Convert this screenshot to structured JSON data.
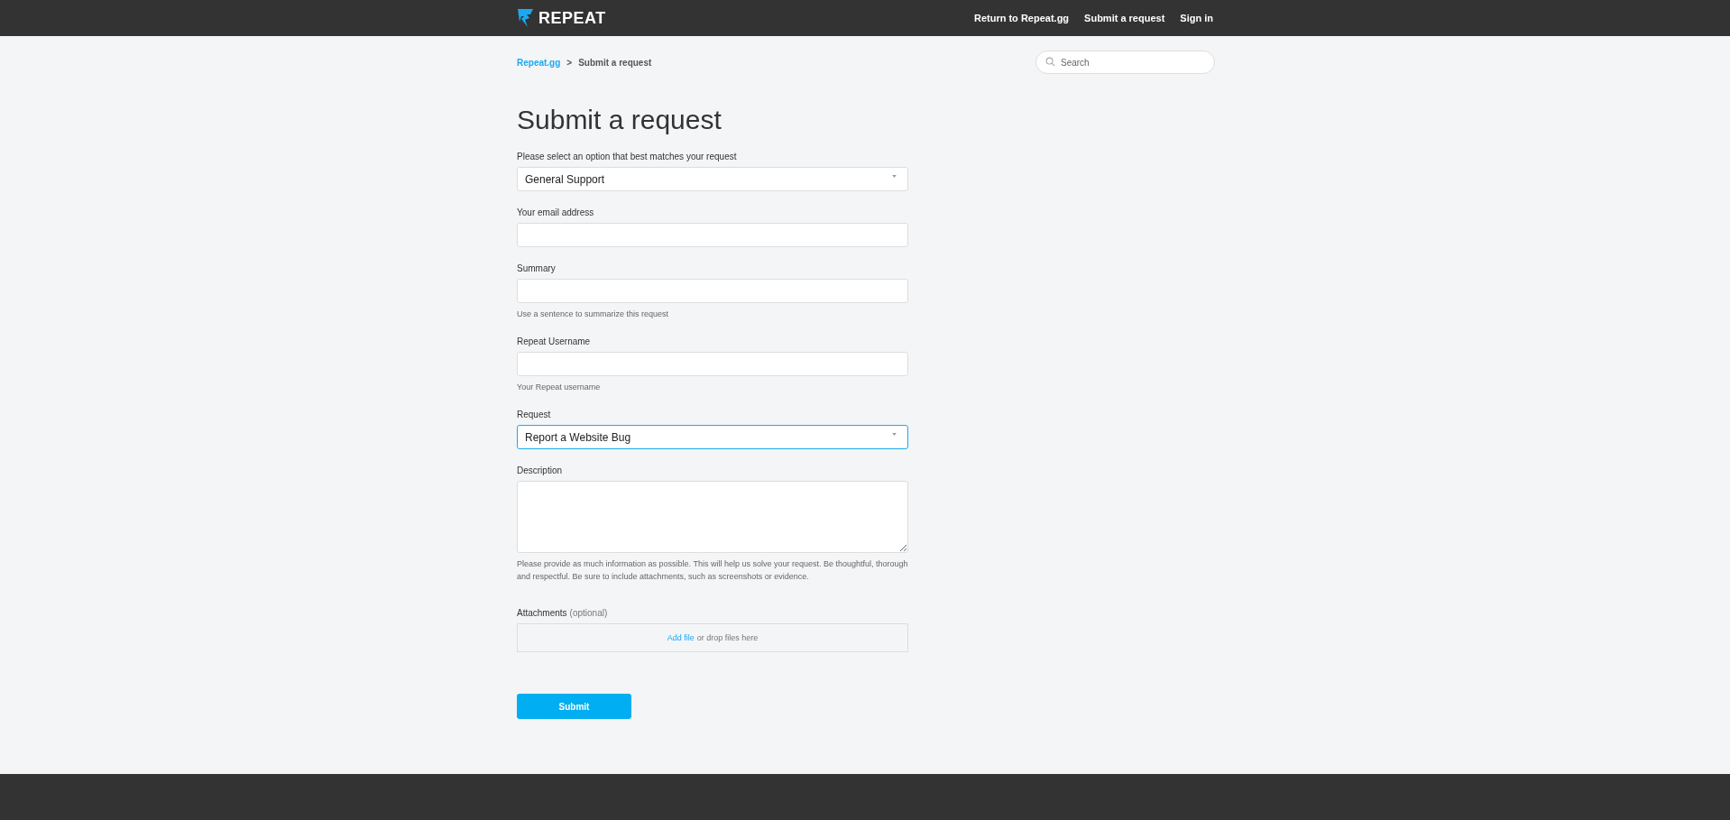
{
  "header": {
    "logo_text": "REPEAT",
    "nav": [
      "Return to Repeat.gg",
      "Submit a request",
      "Sign in"
    ]
  },
  "breadcrumbs": [
    {
      "label": "Repeat.gg",
      "link": true
    },
    {
      "label": ">",
      "link": false
    },
    {
      "label": "Submit a request",
      "link": false
    }
  ],
  "search": {
    "placeholder": "Search"
  },
  "title": "Submit a request",
  "fields": [
    {
      "kind": "select",
      "label": "Please select an option that best matches your request",
      "value": "General Support",
      "focused": false
    },
    {
      "kind": "text",
      "label": "Your email address",
      "focused": false
    },
    {
      "kind": "text",
      "label": "Summary",
      "hint": "Use a sentence to summarize this request",
      "focused": false
    },
    {
      "kind": "text",
      "label": "Repeat Username",
      "hint": "Your Repeat username",
      "focused": false
    },
    {
      "kind": "select",
      "label": "Request",
      "value": "Report a Website Bug",
      "focused": true
    },
    {
      "kind": "textarea",
      "label": "Description",
      "hint": "Please provide as much information as possible. This will help us solve your request. Be thoughtful, thorough and respectful. Be sure to include attachments, such as screenshots or evidence.",
      "focused": false
    },
    {
      "kind": "file",
      "label": "Attachments",
      "optional_note": "(optional)",
      "link": "Add file",
      "drop_text": "or drop files here",
      "focused": false
    }
  ],
  "submit": "Submit"
}
